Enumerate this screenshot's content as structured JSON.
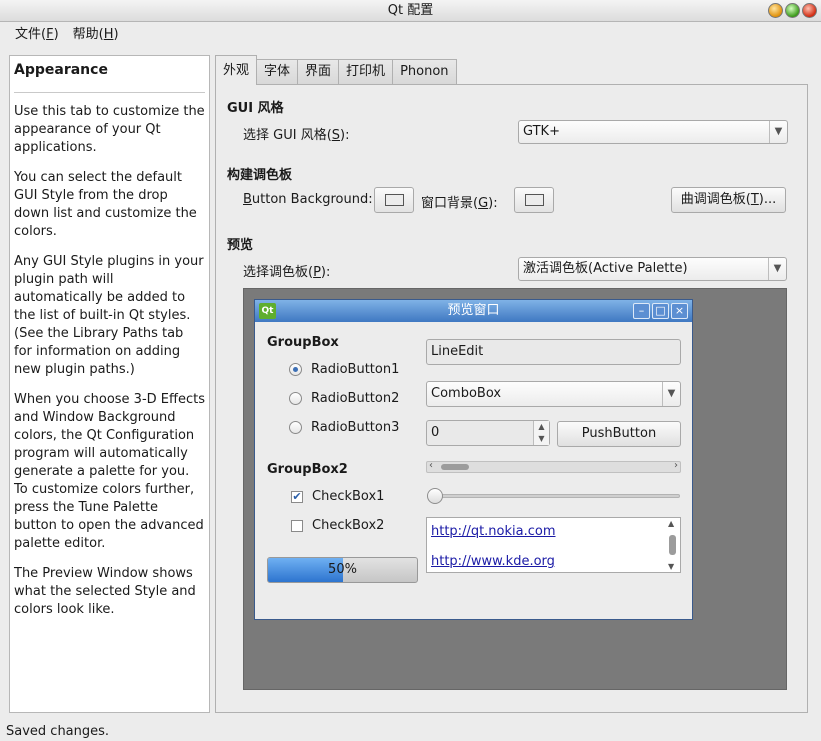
{
  "window": {
    "title": "Qt 配置"
  },
  "menubar": [
    {
      "label_pre": "文件(",
      "mnemonic": "F",
      "label_post": ")"
    },
    {
      "label_pre": "帮助(",
      "mnemonic": "H",
      "label_post": ")"
    }
  ],
  "help": {
    "title": "Appearance",
    "paragraphs": [
      "Use this tab to customize the appearance of your Qt applications.",
      "You can select the default GUI Style from the drop down list and customize the colors.",
      "Any GUI Style plugins in your plugin path will automatically be added to the list of built-in Qt styles. (See the Library Paths tab for information on adding new plugin paths.)",
      "When you choose 3-D Effects and Window Background colors, the Qt Configuration program will automatically generate a palette for you. To customize colors further, press the Tune Palette button to open the advanced palette editor.",
      "The Preview Window shows what the selected Style and colors look like."
    ]
  },
  "tabs": [
    "外观",
    "字体",
    "界面",
    "打印机",
    "Phonon"
  ],
  "active_tab": "外观",
  "gui_style": {
    "section_title": "GUI 风格",
    "select_label_pre": "选择 GUI 风格(",
    "select_label_mnemonic": "S",
    "select_label_post": "):",
    "selected_value": "GTK+"
  },
  "palette": {
    "section_title": "构建调色板",
    "button_bg_mnemonic": "B",
    "button_bg_rest": "utton Background:",
    "window_bg_pre": "窗口背景(",
    "window_bg_mnemonic": "G",
    "window_bg_post": "):",
    "tune_pre": "曲调调色板(",
    "tune_mnemonic": "T",
    "tune_post": ")..."
  },
  "preview": {
    "section_title": "预览",
    "select_label_pre": "选择调色板(",
    "select_label_mnemonic": "P",
    "select_label_post": "):",
    "selected_value": "激活调色板(Active Palette)",
    "window": {
      "logo": "Qt",
      "title": "预览窗口",
      "groupbox1": "GroupBox",
      "radios": [
        "RadioButton1",
        "RadioButton2",
        "RadioButton3"
      ],
      "radio_selected": 0,
      "groupbox2": "GroupBox2",
      "checks": [
        "CheckBox1",
        "CheckBox2"
      ],
      "checked": [
        true,
        false
      ],
      "lineedit": "LineEdit",
      "combobox": "ComboBox",
      "spin_value": "0",
      "pushbutton": "PushButton",
      "links": [
        "http://qt.nokia.com",
        "http://www.kde.org"
      ],
      "progress_value": 50,
      "progress_text": "50%",
      "slider_value": 0
    }
  },
  "status": "Saved changes."
}
